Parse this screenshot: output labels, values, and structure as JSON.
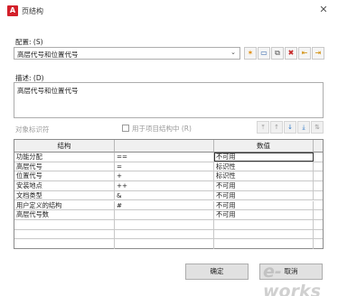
{
  "window": {
    "title": "页结构",
    "close_glyph": "✕",
    "app_glyph": "A"
  },
  "config": {
    "label": "配置: (S)",
    "value": "高层代号和位置代号",
    "dropdown_glyph": "⌄"
  },
  "description": {
    "label": "描述: (D)",
    "value": "高层代号和位置代号"
  },
  "objects": {
    "label": "对象标识符",
    "checkbox_label": "用于项目结构中 (R)"
  },
  "toolbar_glyphs": [
    "✶",
    "▭",
    "⧉",
    "✖",
    "⇤",
    "⇥"
  ],
  "toolbar2_glyphs": [
    "⤒",
    "↑",
    "↓",
    "⤓",
    "⇅"
  ],
  "table": {
    "headers": [
      "结构",
      "",
      "数值"
    ],
    "rows": [
      [
        "功能分配",
        "==",
        "不可用"
      ],
      [
        "高层代号",
        "=",
        "标识性"
      ],
      [
        "位置代号",
        "+",
        "标识性"
      ],
      [
        "安装地点",
        "++",
        "不可用"
      ],
      [
        "文档类型",
        "&",
        "不可用"
      ],
      [
        "用户定义的结构",
        "#",
        "不可用"
      ],
      [
        "高层代号数",
        "",
        "不可用"
      ],
      [
        "",
        "",
        ""
      ],
      [
        "",
        "",
        ""
      ],
      [
        "",
        "",
        ""
      ]
    ]
  },
  "buttons": {
    "ok": "确定",
    "cancel": "取消"
  },
  "watermark": "e-works"
}
